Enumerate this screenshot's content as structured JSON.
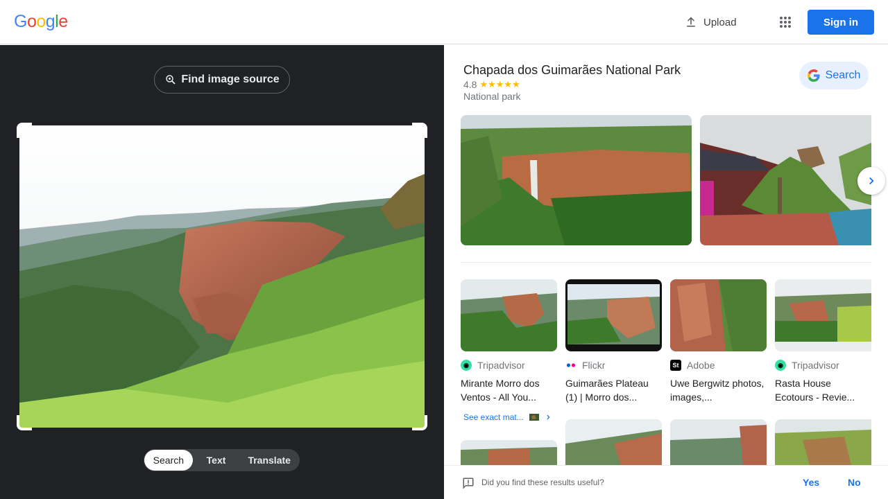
{
  "header": {
    "logo_letters": [
      "G",
      "o",
      "o",
      "g",
      "l",
      "e"
    ],
    "upload_label": "Upload",
    "signin_label": "Sign in"
  },
  "lens": {
    "find_source_label": "Find image source",
    "tabs": [
      "Search",
      "Text",
      "Translate"
    ],
    "active_tab": "Search"
  },
  "knowledge_panel": {
    "title": "Chapada dos Guimarães National Park",
    "rating": "4.8",
    "stars": "★★★★★",
    "type": "National park",
    "search_label": "Search"
  },
  "results": [
    {
      "source": "Tripadvisor",
      "title": "Mirante Morro dos Ventos - All You..."
    },
    {
      "source": "Flickr",
      "title": "Guimarães Plateau (1) | Morro dos..."
    },
    {
      "source": "Adobe",
      "title": "Uwe Bergwitz photos, images,..."
    },
    {
      "source": "Tripadvisor",
      "title": "Rasta House Ecotours - Revie..."
    }
  ],
  "exact_match_label": "See exact mat...",
  "feedback": {
    "question": "Did you find these results useful?",
    "yes": "Yes",
    "no": "No"
  },
  "colors": {
    "brand_blue": "#1a73e8",
    "dark_panel": "#202124",
    "star": "#fbbc04"
  }
}
